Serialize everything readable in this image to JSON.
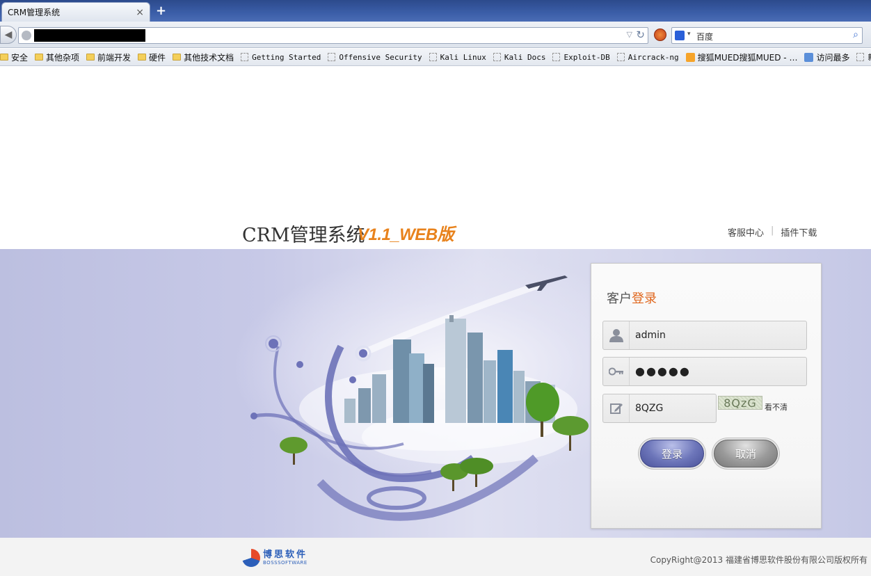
{
  "browser": {
    "tab_title": "CRM管理系统",
    "tab_close": "×",
    "new_tab": "+",
    "search_engine": "百度",
    "bookmarks": [
      {
        "label": "安全",
        "type": "folder"
      },
      {
        "label": "其他杂项",
        "type": "folder"
      },
      {
        "label": "前端开发",
        "type": "folder"
      },
      {
        "label": "硬件",
        "type": "folder"
      },
      {
        "label": "其他技术文档",
        "type": "folder"
      },
      {
        "label": "Getting Started",
        "type": "page"
      },
      {
        "label": "Offensive Security",
        "type": "page"
      },
      {
        "label": "Kali Linux",
        "type": "page"
      },
      {
        "label": "Kali Docs",
        "type": "page"
      },
      {
        "label": "Exploit-DB",
        "type": "page"
      },
      {
        "label": "Aircrack-ng",
        "type": "page"
      },
      {
        "label": "搜狐MUED搜狐MUED - …",
        "type": "rss"
      },
      {
        "label": "访问最多",
        "type": "web"
      },
      {
        "label": "新手上",
        "type": "page"
      }
    ]
  },
  "header": {
    "title": "CRM管理系统",
    "version": "V1.1_WEB版",
    "links": [
      "客服中心",
      "插件下载"
    ]
  },
  "login": {
    "title_prefix": "客户",
    "title_accent": "登录",
    "username": "admin",
    "password_mask": "●●●●●",
    "captcha_input": "8QZG",
    "captcha_image_text": "8QzG",
    "cant_see": "看不清",
    "login_button": "登录",
    "cancel_button": "取消"
  },
  "footer": {
    "brand_cn": "博思软件",
    "brand_en": "BOSSSOFTWARE",
    "copyright": "CopyRight@2013 福建省博思软件股份有限公司版权所有"
  },
  "colors": {
    "accent_orange": "#e0661c",
    "browser_blue": "#3b5ea8",
    "banner_lavender": "#c5c8e6"
  }
}
